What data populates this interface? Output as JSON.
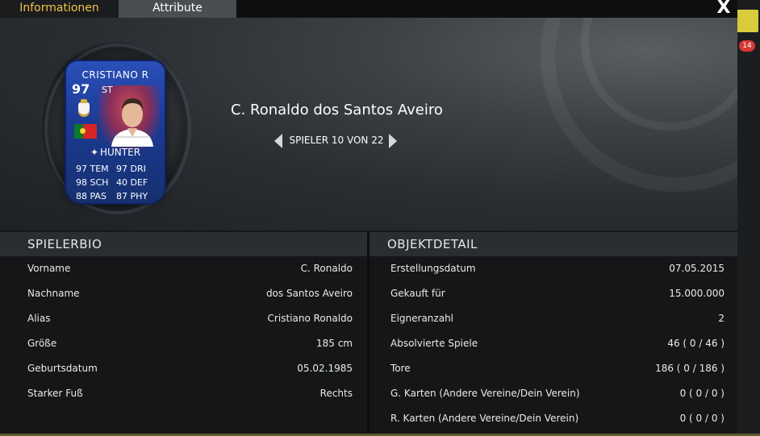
{
  "tabs": {
    "info_label": "Informationen",
    "attr_label": "Attribute"
  },
  "close_label": "X",
  "background": {
    "badge_count": "14"
  },
  "card": {
    "name": "CRISTIANO R",
    "rating": "97",
    "position": "ST",
    "chemistry_style": "HUNTER",
    "stats": [
      [
        "97 TEM",
        "97 DRI"
      ],
      [
        "98 SCH",
        "40 DEF"
      ],
      [
        "88 PAS",
        "87 PHY"
      ]
    ],
    "colors": {
      "card": "#1b3a93",
      "accent": "#c64d5c"
    }
  },
  "player": {
    "full_name": "C. Ronaldo dos Santos Aveiro",
    "pager": "SPIELER 10 VON 22"
  },
  "bio": {
    "title": "SPIELERBIO",
    "rows": [
      {
        "label": "Vorname",
        "value": "C. Ronaldo"
      },
      {
        "label": "Nachname",
        "value": "dos Santos Aveiro"
      },
      {
        "label": "Alias",
        "value": "Cristiano Ronaldo"
      },
      {
        "label": "Größe",
        "value": "185 cm"
      },
      {
        "label": "Geburtsdatum",
        "value": "05.02.1985"
      },
      {
        "label": "Starker Fuß",
        "value": "Rechts"
      }
    ]
  },
  "details": {
    "title": "OBJEKTDETAIL",
    "rows": [
      {
        "label": "Erstellungsdatum",
        "value": "07.05.2015"
      },
      {
        "label": "Gekauft für",
        "value": "15.000.000"
      },
      {
        "label": "Eigneranzahl",
        "value": "2"
      },
      {
        "label": "Absolvierte Spiele",
        "value": "46 ( 0 / 46 )"
      },
      {
        "label": "Tore",
        "value": "186 ( 0 / 186 )"
      },
      {
        "label": "G. Karten (Andere Vereine/Dein Verein)",
        "value": "0 ( 0 / 0 )"
      },
      {
        "label": "R. Karten (Andere Vereine/Dein Verein)",
        "value": "0 ( 0 / 0 )"
      }
    ]
  },
  "icons": {
    "close": "close-icon",
    "prev": "arrow-left-icon",
    "next": "arrow-right-icon",
    "club": "club-crest-icon",
    "nation": "portugal-flag-icon",
    "chemistry": "chemistry-style-icon"
  }
}
